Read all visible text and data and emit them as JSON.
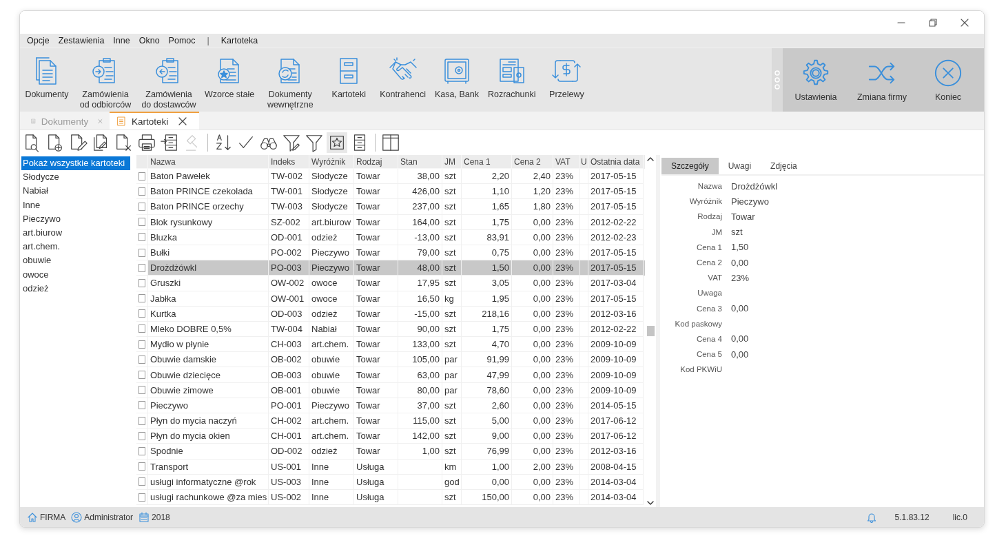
{
  "menu": [
    {
      "kind": "item",
      "label": "Opcje"
    },
    {
      "kind": "item",
      "label": "Zestawienia"
    },
    {
      "kind": "item",
      "label": "Inne"
    },
    {
      "kind": "item",
      "label": "Okno"
    },
    {
      "kind": "item",
      "label": "Pomoc"
    },
    {
      "kind": "separator",
      "label": "|"
    },
    {
      "kind": "item",
      "label": "Kartoteka"
    }
  ],
  "ribbon": {
    "buttons": [
      {
        "label": "Dokumenty"
      },
      {
        "label": "Zamówienia od odbiorców"
      },
      {
        "label": "Zamówienia do dostawców"
      },
      {
        "label": "Wzorce stałe"
      },
      {
        "label": "Dokumenty wewnętrzne"
      },
      {
        "label": "Kartoteki"
      },
      {
        "label": "Kontrahenci"
      },
      {
        "label": "Kasa, Bank"
      },
      {
        "label": "Rozrachunki"
      },
      {
        "label": "Przelewy"
      }
    ],
    "right_buttons": [
      {
        "label": "Ustawienia"
      },
      {
        "label": "Zmiana firmy"
      },
      {
        "label": "Koniec"
      }
    ]
  },
  "doc_tabs": [
    {
      "label": "Dokumenty",
      "selected": false
    },
    {
      "label": "Kartoteki",
      "selected": true
    }
  ],
  "toolbar": [
    {
      "kind": "button",
      "disabled": false,
      "pressed": false
    },
    {
      "kind": "button",
      "disabled": false,
      "pressed": false
    },
    {
      "kind": "button",
      "disabled": false,
      "pressed": false
    },
    {
      "kind": "button",
      "disabled": false,
      "pressed": false
    },
    {
      "kind": "button",
      "disabled": false,
      "pressed": false
    },
    {
      "kind": "button",
      "disabled": false,
      "pressed": false
    },
    {
      "kind": "button",
      "disabled": false,
      "pressed": false
    },
    {
      "kind": "button",
      "disabled": true,
      "pressed": false
    },
    {
      "kind": "separator"
    },
    {
      "kind": "button",
      "disabled": false,
      "pressed": false
    },
    {
      "kind": "button",
      "disabled": false,
      "pressed": false
    },
    {
      "kind": "button",
      "disabled": false,
      "pressed": false
    },
    {
      "kind": "button",
      "disabled": false,
      "pressed": false
    },
    {
      "kind": "button",
      "disabled": false,
      "pressed": false
    },
    {
      "kind": "button",
      "disabled": false,
      "pressed": true
    },
    {
      "kind": "button",
      "disabled": false,
      "pressed": false
    },
    {
      "kind": "separator"
    },
    {
      "kind": "button",
      "disabled": false,
      "pressed": false
    }
  ],
  "categories": [
    {
      "label": "Pokaż wszystkie kartoteki",
      "selected": true
    },
    {
      "label": "Słodycze",
      "selected": false
    },
    {
      "label": "Nabiał",
      "selected": false
    },
    {
      "label": "Inne",
      "selected": false
    },
    {
      "label": "Pieczywo",
      "selected": false
    },
    {
      "label": "art.biurow",
      "selected": false
    },
    {
      "label": "art.chem.",
      "selected": false
    },
    {
      "label": "obuwie",
      "selected": false
    },
    {
      "label": "owoce",
      "selected": false
    },
    {
      "label": "odzież",
      "selected": false
    }
  ],
  "table": {
    "columns": [
      "Nazwa",
      "Indeks",
      "Wyróżnik",
      "Rodzaj",
      "Stan",
      "JM",
      "Cena 1",
      "Cena 2",
      "VAT",
      "U",
      "Ostatnia data"
    ],
    "rows": [
      {
        "checked": false,
        "selected": false,
        "cells": [
          "Baton Pawełek",
          "TW-002",
          "Słodycze",
          "Towar",
          "38,00",
          "szt",
          "2,20",
          "2,40",
          "23%",
          "",
          "2017-05-15"
        ]
      },
      {
        "checked": false,
        "selected": false,
        "cells": [
          "Baton PRINCE czekolada",
          "TW-001",
          "Słodycze",
          "Towar",
          "426,00",
          "szt",
          "1,10",
          "1,20",
          "23%",
          "",
          "2017-05-15"
        ]
      },
      {
        "checked": false,
        "selected": false,
        "cells": [
          "Baton PRINCE orzechy",
          "TW-003",
          "Słodycze",
          "Towar",
          "237,00",
          "szt",
          "1,65",
          "1,80",
          "23%",
          "",
          "2017-05-15"
        ]
      },
      {
        "checked": false,
        "selected": false,
        "cells": [
          "Blok rysunkowy",
          "SZ-002",
          "art.biurow",
          "Towar",
          "164,00",
          "szt",
          "1,75",
          "0,00",
          "23%",
          "",
          "2012-02-22"
        ]
      },
      {
        "checked": false,
        "selected": false,
        "cells": [
          "Bluzka",
          "OD-001",
          "odzież",
          "Towar",
          "-13,00",
          "szt",
          "83,91",
          "0,00",
          "23%",
          "",
          "2012-02-23"
        ]
      },
      {
        "checked": false,
        "selected": false,
        "cells": [
          "Bułki",
          "PO-002",
          "Pieczywo",
          "Towar",
          "79,00",
          "szt",
          "0,75",
          "0,00",
          "23%",
          "",
          "2017-05-15"
        ]
      },
      {
        "checked": false,
        "selected": true,
        "cells": [
          "Drożdżówkl",
          "PO-003",
          "Pieczywo",
          "Towar",
          "48,00",
          "szt",
          "1,50",
          "0,00",
          "23%",
          "",
          "2017-05-15"
        ]
      },
      {
        "checked": false,
        "selected": false,
        "cells": [
          "Gruszki",
          "OW-002",
          "owoce",
          "Towar",
          "17,95",
          "szt",
          "3,05",
          "0,00",
          "23%",
          "",
          "2017-03-04"
        ]
      },
      {
        "checked": false,
        "selected": false,
        "cells": [
          "Jabłka",
          "OW-001",
          "owoce",
          "Towar",
          "16,50",
          "kg",
          "1,95",
          "0,00",
          "23%",
          "",
          "2017-05-15"
        ]
      },
      {
        "checked": false,
        "selected": false,
        "cells": [
          "Kurtka",
          "OD-003",
          "odzież",
          "Towar",
          "-15,00",
          "szt",
          "218,16",
          "0,00",
          "23%",
          "",
          "2012-03-16"
        ]
      },
      {
        "checked": false,
        "selected": false,
        "cells": [
          "Mleko DOBRE 0,5%",
          "TW-004",
          "Nabiał",
          "Towar",
          "90,00",
          "szt",
          "1,75",
          "0,00",
          "23%",
          "",
          "2012-02-22"
        ]
      },
      {
        "checked": false,
        "selected": false,
        "cells": [
          "Mydło w płynie",
          "CH-003",
          "art.chem.",
          "Towar",
          "133,00",
          "szt",
          "4,70",
          "0,00",
          "23%",
          "",
          "2009-10-09"
        ]
      },
      {
        "checked": false,
        "selected": false,
        "cells": [
          "Obuwie damskie",
          "OB-002",
          "obuwie",
          "Towar",
          "105,00",
          "par",
          "91,99",
          "0,00",
          "23%",
          "",
          "2009-10-09"
        ]
      },
      {
        "checked": false,
        "selected": false,
        "cells": [
          "Obuwie dziecięce",
          "OB-003",
          "obuwie",
          "Towar",
          "63,00",
          "par",
          "47,99",
          "0,00",
          "23%",
          "",
          "2009-10-09"
        ]
      },
      {
        "checked": false,
        "selected": false,
        "cells": [
          "Obuwie zimowe",
          "OB-001",
          "obuwie",
          "Towar",
          "80,00",
          "par",
          "78,60",
          "0,00",
          "23%",
          "",
          "2009-10-09"
        ]
      },
      {
        "checked": false,
        "selected": false,
        "cells": [
          "Pieczywo",
          "PO-001",
          "Pieczywo",
          "Towar",
          "37,00",
          "szt",
          "2,60",
          "0,00",
          "23%",
          "",
          "2014-05-15"
        ]
      },
      {
        "checked": false,
        "selected": false,
        "cells": [
          "Płyn do mycia naczyń",
          "CH-002",
          "art.chem.",
          "Towar",
          "115,00",
          "szt",
          "5,00",
          "0,00",
          "23%",
          "",
          "2017-06-12"
        ]
      },
      {
        "checked": false,
        "selected": false,
        "cells": [
          "Płyn do mycia okien",
          "CH-001",
          "art.chem.",
          "Towar",
          "142,00",
          "szt",
          "9,00",
          "0,00",
          "23%",
          "",
          "2017-06-12"
        ]
      },
      {
        "checked": false,
        "selected": false,
        "cells": [
          "Spodnie",
          "OD-002",
          "odzież",
          "Towar",
          "1,00",
          "szt",
          "76,99",
          "0,00",
          "23%",
          "",
          "2012-03-16"
        ]
      },
      {
        "checked": false,
        "selected": false,
        "cells": [
          "Transport",
          "US-001",
          "Inne",
          "Usługa",
          "",
          "km",
          "1,00",
          "2,00",
          "23%",
          "",
          "2008-04-15"
        ]
      },
      {
        "checked": false,
        "selected": false,
        "cells": [
          "usługi informatyczne @rok",
          "US-003",
          "Inne",
          "Usługa",
          "",
          "god",
          "0,00",
          "0,00",
          "23%",
          "",
          "2014-03-04"
        ]
      },
      {
        "checked": false,
        "selected": false,
        "cells": [
          "usługi rachunkowe @za mies",
          "US-002",
          "Inne",
          "Usługa",
          "",
          "szt",
          "150,00",
          "0,00",
          "23%",
          "",
          "2014-03-04"
        ]
      }
    ]
  },
  "details": {
    "tabs": [
      {
        "label": "Szczegóły",
        "selected": true
      },
      {
        "label": "Uwagi",
        "selected": false
      },
      {
        "label": "Zdjęcia",
        "selected": false
      }
    ],
    "fields": [
      {
        "label": "Nazwa",
        "value": "Drożdżówkl"
      },
      {
        "label": "Wyróżnik",
        "value": "Pieczywo"
      },
      {
        "label": "Rodzaj",
        "value": "Towar"
      },
      {
        "label": "JM",
        "value": "szt"
      },
      {
        "label": "Cena 1",
        "value": "1,50"
      },
      {
        "label": "Cena 2",
        "value": "0,00"
      },
      {
        "label": "VAT",
        "value": "23%"
      },
      {
        "label": "Uwaga"
      },
      {
        "label": "Cena 3",
        "value": "0,00"
      },
      {
        "label": "Kod paskowy"
      },
      {
        "label": "Cena 4",
        "value": "0,00"
      },
      {
        "label": "Cena 5",
        "value": "0,00"
      },
      {
        "label": "Kod PKWiU"
      }
    ]
  },
  "status_bar": {
    "company": "FIRMA",
    "user": "Administrator",
    "year": "2018",
    "version": "5.1.83.12",
    "license": "lic.0"
  }
}
